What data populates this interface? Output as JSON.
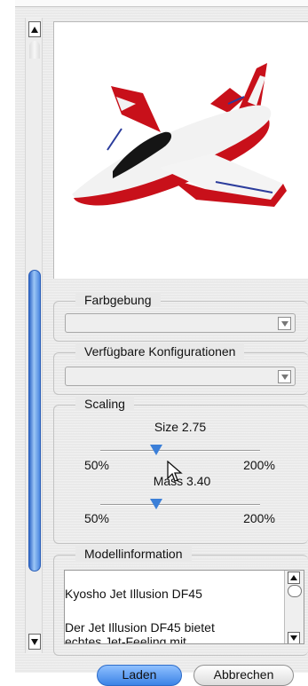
{
  "groups": {
    "color_scheme": {
      "title": "Farbgebung",
      "selected": ""
    },
    "configurations": {
      "title": "Verfügbare Konfigurationen",
      "selected": ""
    },
    "scaling": {
      "title": "Scaling",
      "size_label": "Size 2.75",
      "mass_label": "Mass 3.40",
      "min_label": "50%",
      "max_label": "200%",
      "size_level": 0.35,
      "mass_level": 0.35
    },
    "model_info": {
      "title": "Modellinformation",
      "line1": "Kyosho Jet Illusion DF45",
      "line2": "Der Jet Illusion DF45 bietet",
      "line3": "echtes Jet-Feeling mit"
    }
  },
  "buttons": {
    "load": "Laden",
    "cancel": "Abbrechen"
  },
  "icons": {
    "scroll_up": "arrow-up-icon",
    "scroll_down": "arrow-down-icon",
    "dropdown": "chevron-down-icon",
    "cursor": "mouse-pointer-icon"
  },
  "colors": {
    "accent": "#3b83e6",
    "aircraft_red": "#c8101a"
  }
}
